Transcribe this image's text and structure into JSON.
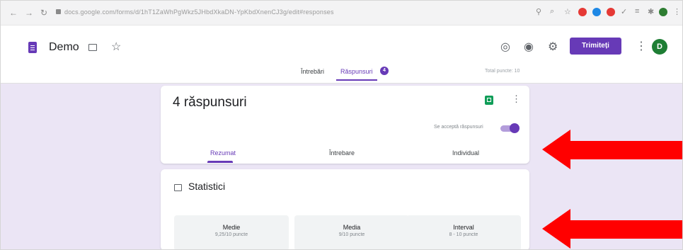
{
  "browser": {
    "url": "docs.google.com/forms/d/1hT1ZaWhPgWkz5JHbdXkaDN-YpKbdXnenCJ3g/edit#responses"
  },
  "header": {
    "doc_title": "Demo",
    "send_label": "Trimiteți",
    "avatar_letter": "D"
  },
  "tabs": {
    "questions": "Întrebări",
    "responses": "Răspunsuri",
    "responses_count": "4",
    "total_points": "Total puncte: 10"
  },
  "responses_card": {
    "title": "4 răspunsuri",
    "accept_label": "Se acceptă răspunsuri",
    "accepting": true,
    "subtabs": [
      "Rezumat",
      "Întrebare",
      "Individual"
    ]
  },
  "stats_card": {
    "title": "Statistici",
    "stats": [
      {
        "label": "Medie",
        "value": "9,25/10 puncte"
      },
      {
        "label": "Media",
        "value": "9/10 puncte"
      },
      {
        "label": "Interval",
        "value": "8 - 10 puncte"
      }
    ]
  },
  "colors": {
    "accent": "#673ab7",
    "workspace": "#ebe5f5",
    "arrow": "#ff0000",
    "sheets": "#0f9d58"
  }
}
